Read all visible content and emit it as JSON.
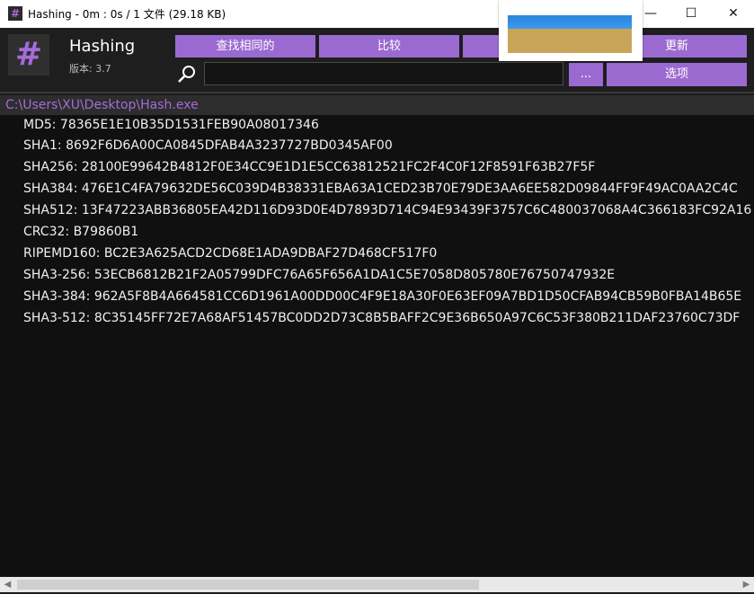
{
  "window": {
    "title": "Hashing - 0m : 0s / 1 文件 (29.18 KB)",
    "minimize_glyph": "—",
    "maximize_glyph": "☐",
    "close_glyph": "✕"
  },
  "header": {
    "app_name": "Hashing",
    "version": "版本: 3.7",
    "logo_glyph": "#"
  },
  "toolbar": {
    "find_identical": "查找相同的",
    "compare": "比较",
    "third": "",
    "update": "更新",
    "dots": "...",
    "options": "选项"
  },
  "search": {
    "value": ""
  },
  "file_path": "C:\\Users\\XU\\Desktop\\Hash.exe",
  "hashes": [
    "MD5: 78365E1E10B35D1531FEB90A08017346",
    "SHA1: 8692F6D6A00CA0845DFAB4A3237727BD0345AF00",
    "SHA256: 28100E99642B4812F0E34CC9E1D1E5CC63812521FC2F4C0F12F8591F63B27F5F",
    "SHA384: 476E1C4FA79632DE56C039D4B38331EBA63A1CED23B70E79DE3AA6EE582D09844FF9F49AC0AA2C4C",
    "SHA512: 13F47223ABB36805EA42D116D93D0E4D7893D714C94E93439F3757C6C480037068A4C366183FC92A16",
    "CRC32: B79860B1",
    "RIPEMD160: BC2E3A625ACD2CD68E1ADA9DBAF27D468CF517F0",
    "SHA3-256: 53ECB6812B21F2A05799DFC76A65F656A1DA1C5E7058D805780E76750747932E",
    "SHA3-384: 962A5F8B4A664581CC6D1961A00DD00C4F9E18A30F0E63EF09A7BD1D50CFAB94CB59B0FBA14B65E",
    "SHA3-512: 8C35145FF72E7A68AF51457BC0DD2D73C8B5BAFF2C9E36B650A97C6C53F380B211DAF23760C73DF"
  ],
  "scrollbar": {
    "left_arrow": "◀",
    "right_arrow": "▶"
  },
  "colors": {
    "accent": "#9b6ad1",
    "path_text": "#a66bd9",
    "background": "#101010"
  }
}
